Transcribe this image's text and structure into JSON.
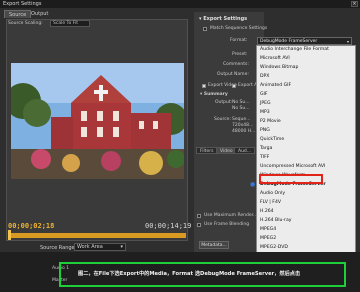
{
  "window": {
    "title": "Export Settings",
    "close": "×"
  },
  "tabs": [
    "Source",
    "Output"
  ],
  "preview": {
    "source_scaling_label": "Source Scaling:",
    "source_scaling_value": "Scale To Fit",
    "time_start": "00;00;02;18",
    "time_end": "00;00;14;19",
    "source_range_label": "Source Range:",
    "source_range_value": "Work Area"
  },
  "export_settings": {
    "header": "Export Settings",
    "match_sequence": "Match Sequence Settings",
    "format_label": "Format:",
    "format_value": "DebugMode FrameServer",
    "preset_label": "Preset:",
    "comments_label": "Comments:",
    "output_name_label": "Output Name:",
    "export_video": "Export Video",
    "export_audio": "Export Au...",
    "summary_label": "Summary",
    "output_label": "Output:",
    "output_lines": [
      "No Su...",
      "No Su..."
    ],
    "source_label": "Source:",
    "source_lines": [
      "Seque...",
      "720x48...",
      "48000 H..."
    ]
  },
  "panel_tabs": [
    "Filters",
    "Video",
    "Aud..."
  ],
  "checkboxes": {
    "max_render": "Use Maximum Render...",
    "frame_blending": "Use Frame Blending"
  },
  "metadata_button": "Metadata...",
  "dropdown": {
    "items": [
      "Audio Interchange File Format",
      "Microsoft AVI",
      "Windows Bitmap",
      "DPX",
      "Animated GIF",
      "GIF",
      "JPEG",
      "MP3",
      "P2 Movie",
      "PNG",
      "QuickTime",
      "Targa",
      "TIFF",
      "Uncompressed Microsoft AVI",
      "Windows Waveform",
      "DebugMode FrameServer",
      "Audio Only",
      "FLV | F4V",
      "H.264",
      "H.264 Blu-ray",
      "MPEG4",
      "MPEG2",
      "MPEG2-DVD",
      "MPEG2 Blu-ray",
      "Windows Media"
    ],
    "selected": "DebugMode FrameServer",
    "highlight_color": "#e2231a"
  },
  "bottom": {
    "audio_label": "Audio 1",
    "master_label": "Master"
  },
  "hint": {
    "text": "图二，在File下选Export中的Media，Format 选DebugMode FrameServer，然后点击",
    "border_color": "#1fcf3a"
  }
}
